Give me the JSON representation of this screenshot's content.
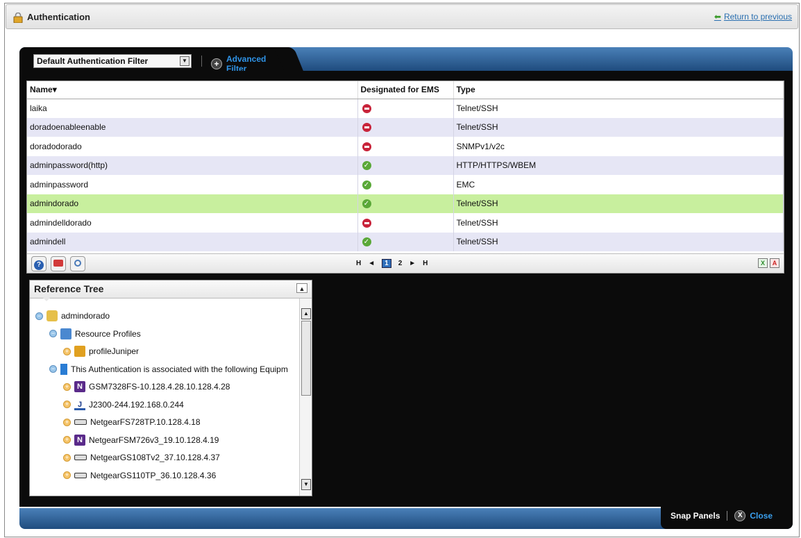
{
  "header": {
    "title": "Authentication",
    "return_link": "Return to previous"
  },
  "filter": {
    "selected": "Default Authentication Filter",
    "advanced_label": "Advanced Filter"
  },
  "grid": {
    "columns": [
      "Name",
      "Designated for EMS",
      "Type"
    ],
    "sort_marker": "▾",
    "rows": [
      {
        "name": "laika",
        "ems": "no",
        "type": "Telnet/SSH"
      },
      {
        "name": "doradoenableenable",
        "ems": "no",
        "type": "Telnet/SSH"
      },
      {
        "name": "doradodorado",
        "ems": "no",
        "type": "SNMPv1/v2c"
      },
      {
        "name": "adminpassword(http)",
        "ems": "yes",
        "type": "HTTP/HTTPS/WBEM"
      },
      {
        "name": "adminpassword",
        "ems": "yes",
        "type": "EMC"
      },
      {
        "name": "admindorado",
        "ems": "yes",
        "type": "Telnet/SSH"
      },
      {
        "name": "admindelldorado",
        "ems": "no",
        "type": "Telnet/SSH"
      },
      {
        "name": "admindell",
        "ems": "yes",
        "type": "Telnet/SSH"
      }
    ],
    "selected_row": "admindorado",
    "pager": {
      "first": "H",
      "prev": "◄",
      "pages": [
        "1",
        "2"
      ],
      "current": "1",
      "next": "►",
      "last": "H"
    }
  },
  "tree": {
    "title": "Reference Tree",
    "nodes": [
      {
        "label": "admindorado",
        "icon": "key-icon",
        "toggle": "minus"
      },
      {
        "label": "Resource Profiles",
        "icon": "profiles-icon",
        "toggle": "minus"
      },
      {
        "label": "profileJuniper",
        "icon": "profile-icon",
        "toggle": "plus"
      },
      {
        "label": "This Authentication is associated with the following Equipm",
        "icon": "book-icon",
        "toggle": "minus"
      },
      {
        "label": "GSM7328FS-10.128.4.28.10.128.4.28",
        "icon": "netgear-icon",
        "toggle": "plus"
      },
      {
        "label": "J2300-244.192.168.0.244",
        "icon": "juniper-icon",
        "toggle": "plus"
      },
      {
        "label": "NetgearFS728TP.10.128.4.18",
        "icon": "device-icon",
        "toggle": "plus"
      },
      {
        "label": "NetgearFSM726v3_19.10.128.4.19",
        "icon": "netgear-icon",
        "toggle": "plus"
      },
      {
        "label": "NetgearGS108Tv2_37.10.128.4.37",
        "icon": "device-icon",
        "toggle": "plus"
      },
      {
        "label": "NetgearGS110TP_36.10.128.4.36",
        "icon": "device-icon",
        "toggle": "plus"
      }
    ]
  },
  "footer": {
    "snap_label": "Snap Panels",
    "close_label": "Close"
  }
}
